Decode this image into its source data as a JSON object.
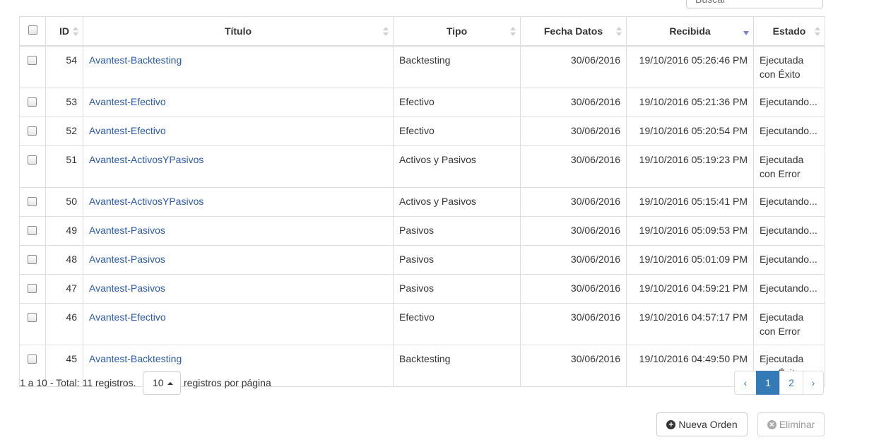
{
  "search": {
    "placeholder": "Buscar"
  },
  "columns": {
    "id": "ID",
    "titulo": "Título",
    "tipo": "Tipo",
    "fecha": "Fecha Datos",
    "recibida": "Recibida",
    "estado": "Estado"
  },
  "rows": [
    {
      "id": "54",
      "titulo": "Avantest-Backtesting",
      "tipo": "Backtesting",
      "fecha": "30/06/2016",
      "recibida": "19/10/2016 05:26:46 PM",
      "estado": "Ejecutada con Éxito"
    },
    {
      "id": "53",
      "titulo": "Avantest-Efectivo",
      "tipo": "Efectivo",
      "fecha": "30/06/2016",
      "recibida": "19/10/2016 05:21:36 PM",
      "estado": "Ejecutando..."
    },
    {
      "id": "52",
      "titulo": "Avantest-Efectivo",
      "tipo": "Efectivo",
      "fecha": "30/06/2016",
      "recibida": "19/10/2016 05:20:54 PM",
      "estado": "Ejecutando..."
    },
    {
      "id": "51",
      "titulo": "Avantest-ActivosYPasivos",
      "tipo": "Activos y Pasivos",
      "fecha": "30/06/2016",
      "recibida": "19/10/2016 05:19:23 PM",
      "estado": "Ejecutada con Error"
    },
    {
      "id": "50",
      "titulo": "Avantest-ActivosYPasivos",
      "tipo": "Activos y Pasivos",
      "fecha": "30/06/2016",
      "recibida": "19/10/2016 05:15:41 PM",
      "estado": "Ejecutando..."
    },
    {
      "id": "49",
      "titulo": "Avantest-Pasivos",
      "tipo": "Pasivos",
      "fecha": "30/06/2016",
      "recibida": "19/10/2016 05:09:53 PM",
      "estado": "Ejecutando..."
    },
    {
      "id": "48",
      "titulo": "Avantest-Pasivos",
      "tipo": "Pasivos",
      "fecha": "30/06/2016",
      "recibida": "19/10/2016 05:01:09 PM",
      "estado": "Ejecutando..."
    },
    {
      "id": "47",
      "titulo": "Avantest-Pasivos",
      "tipo": "Pasivos",
      "fecha": "30/06/2016",
      "recibida": "19/10/2016 04:59:21 PM",
      "estado": "Ejecutando..."
    },
    {
      "id": "46",
      "titulo": "Avantest-Efectivo",
      "tipo": "Efectivo",
      "fecha": "30/06/2016",
      "recibida": "19/10/2016 04:57:17 PM",
      "estado": "Ejecutada con Error"
    },
    {
      "id": "45",
      "titulo": "Avantest-Backtesting",
      "tipo": "Backtesting",
      "fecha": "30/06/2016",
      "recibida": "19/10/2016 04:49:50 PM",
      "estado": "Ejecutada con Éxito"
    }
  ],
  "footer": {
    "summary": "1 a 10 - Total: 11 registros.",
    "page_size": "10",
    "per_page_label": "registros por página"
  },
  "pagination": {
    "prev": "‹",
    "pages": [
      "1",
      "2"
    ],
    "current": "1",
    "next": "›"
  },
  "actions": {
    "new_order": "Nueva Orden",
    "delete": "Eliminar"
  },
  "colors": {
    "link": "#2a5aa8",
    "accent": "#337ab7",
    "sort_active": "#7b7fc9"
  }
}
